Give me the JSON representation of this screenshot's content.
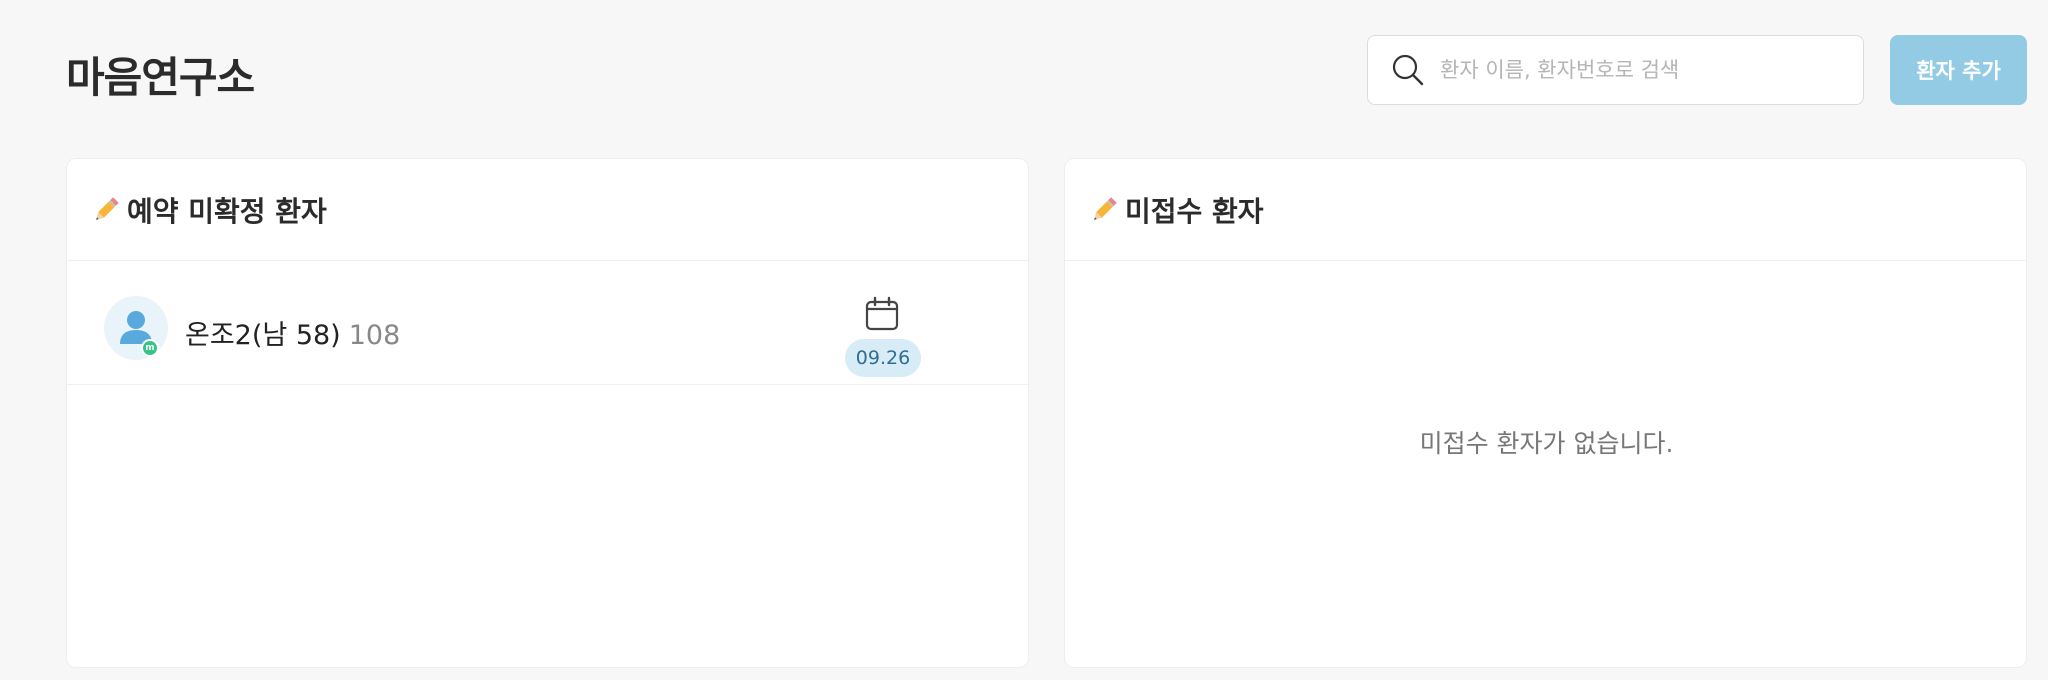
{
  "header": {
    "title": "마음연구소",
    "search_placeholder": "환자 이름, 환자번호로 검색",
    "search_value": "",
    "add_button_label": "환자 추가"
  },
  "panels": {
    "unconfirmed": {
      "icon": "pencil-icon",
      "title": "예약 미확정 환자",
      "patients": [
        {
          "name": "온조2(남 58)",
          "number": "108",
          "avatar_icon": "person-icon",
          "badge_letter": "m",
          "date_icon": "calendar-icon",
          "date": "09.26"
        }
      ]
    },
    "unpaid": {
      "icon": "pencil-icon",
      "title": "미접수 환자",
      "empty_message": "미접수 환자가 없습니다."
    }
  },
  "colors": {
    "accent": "#93cbe5",
    "date_pill_bg": "#d8ecf7",
    "badge": "#36c48b"
  }
}
